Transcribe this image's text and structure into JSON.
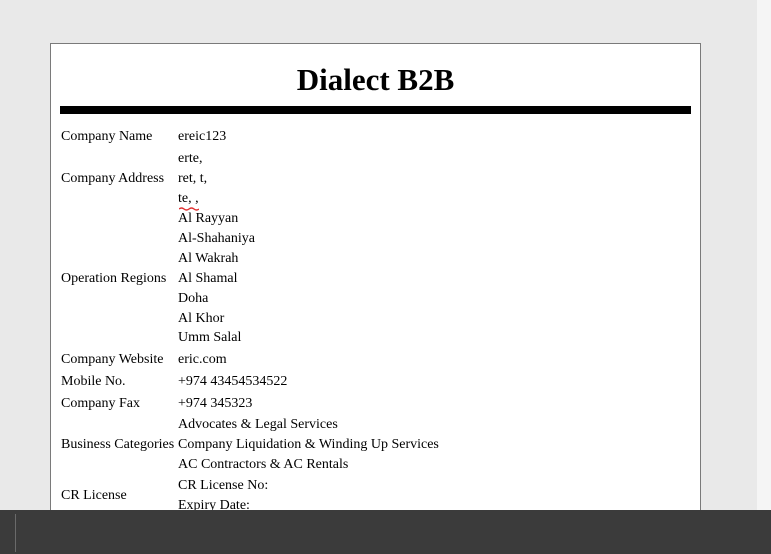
{
  "document": {
    "title": "Dialect B2B"
  },
  "fields": {
    "company_name": {
      "label": "Company Name",
      "value": "ereic123"
    },
    "company_address": {
      "label": "Company Address",
      "lines": [
        "erte,",
        "ret, t,",
        "te, ,"
      ]
    },
    "operation_regions": {
      "label": "Operation Regions",
      "lines": [
        "Al Rayyan",
        "Al-Shahaniya",
        "Al Wakrah",
        "Al Shamal",
        "Doha",
        "Al Khor",
        "Umm Salal"
      ]
    },
    "company_website": {
      "label": "Company Website",
      "value": "eric.com"
    },
    "mobile_no": {
      "label": "Mobile No.",
      "value": "+974 43454534522"
    },
    "company_fax": {
      "label": "Company Fax",
      "value": "+974 345323"
    },
    "business_categories": {
      "label": "Business Categories",
      "lines": [
        "Advocates & Legal Services",
        "Company Liquidation & Winding Up Services",
        "AC Contractors & AC Rentals"
      ]
    },
    "cr_license": {
      "label": "CR License",
      "lines": [
        "CR License No:",
        "Expiry Date:"
      ]
    }
  },
  "colors": {
    "spellcheck_underline": "#e03030"
  }
}
